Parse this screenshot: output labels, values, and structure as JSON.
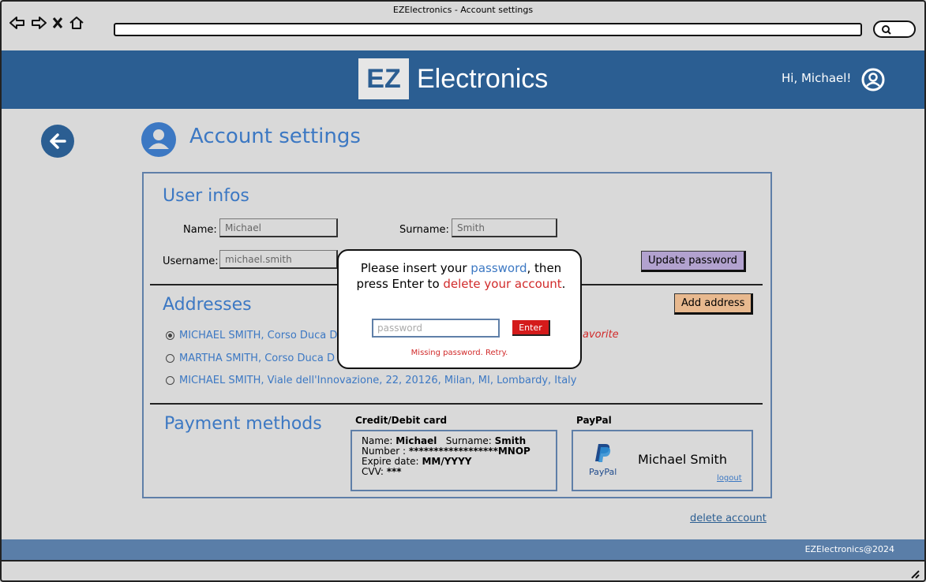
{
  "window": {
    "title": "EZElectronics - Account settings"
  },
  "header": {
    "logo_box": "EZ",
    "logo_text": "Electronics",
    "greeting": "Hi, Michael!"
  },
  "page": {
    "title": "Account settings"
  },
  "user_infos": {
    "title": "User infos",
    "name_label": "Name:",
    "name_value": "Michael",
    "surname_label": "Surname:",
    "surname_value": "Smith",
    "username_label": "Username:",
    "username_value": "michael.smith",
    "update_password": "Update password"
  },
  "addresses": {
    "title": "Addresses",
    "add_address": "Add address",
    "items": [
      {
        "text": "MICHAEL SMITH, Corso Duca D",
        "selected": true
      },
      {
        "text": "MARTHA SMITH, Corso Duca D",
        "selected": false
      },
      {
        "text": "MICHAEL SMITH, Viale dell'Innovazione, 22, 20126, Milan, MI, Lombardy, Italy",
        "selected": false
      }
    ],
    "favorite_fragment": "avorite"
  },
  "payment": {
    "title": "Payment methods",
    "card_heading": "Credit/Debit card",
    "card": {
      "name_label": "Name:",
      "name": "Michael",
      "surname_label": "Surname:",
      "surname": "Smith",
      "number_label": "Number :",
      "number": "******************MNOP",
      "expire_label": "Expire date:",
      "expire": "MM/YYYY",
      "cvv_label": "CVV:",
      "cvv": "***"
    },
    "paypal_heading": "PayPal",
    "paypal": {
      "logo_label": "PayPal",
      "name": "Michael Smith",
      "logout": "logout"
    }
  },
  "delete_account": "delete account",
  "modal": {
    "msg_part1": "Please insert your ",
    "msg_password": "password",
    "msg_part2": ", then press Enter to ",
    "msg_delete": "delete your account",
    "msg_end": ".",
    "placeholder": "password",
    "enter": "Enter",
    "error": "Missing password. Retry."
  },
  "footer": {
    "text": "EZElectronics@2024"
  },
  "colors": {
    "header": "#2b5e92",
    "accent": "#3c78c3",
    "danger": "#d12a2a",
    "footer": "#5a7ea8"
  }
}
